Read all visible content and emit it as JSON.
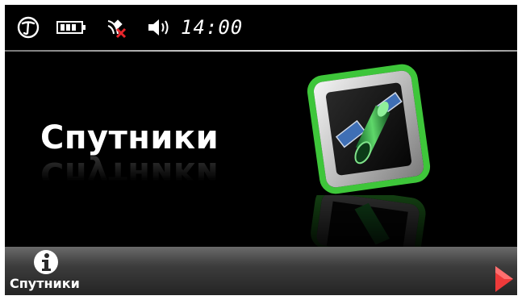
{
  "status": {
    "time": "14:00",
    "icons": [
      "gps-logo-icon",
      "battery-icon",
      "satellite-signal-icon",
      "volume-icon"
    ]
  },
  "main": {
    "title": "Спутники",
    "tile_icon": "satellite-icon"
  },
  "bottom": {
    "label": "Спутники",
    "info_icon": "info-icon",
    "next_icon": "play-arrow-icon"
  },
  "colors": {
    "accent_green": "#3ec63a",
    "background": "#000000",
    "arrow_red": "#ee3a3a"
  }
}
